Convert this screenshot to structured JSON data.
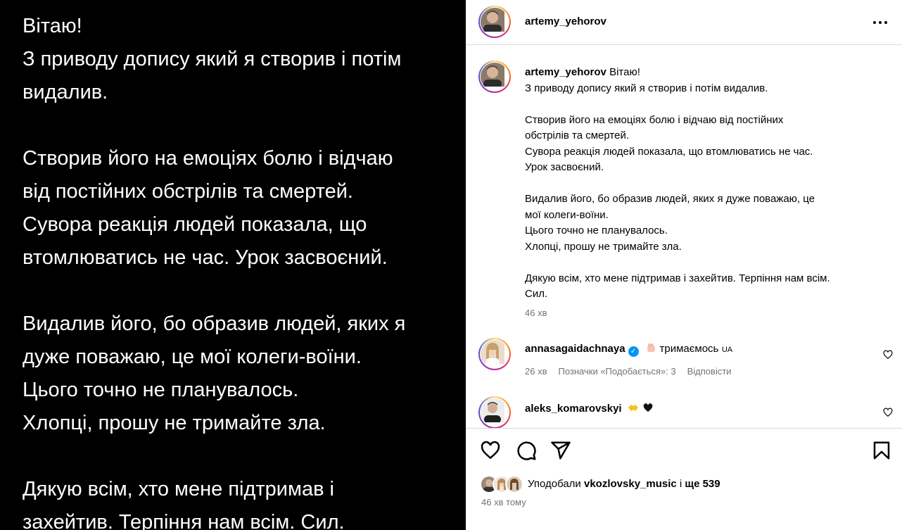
{
  "media": {
    "lines": [
      "Вітаю!",
      "З приводу допису який я створив і потім",
      "видалив.",
      "",
      "Створив його на емоціях болю і відчаю",
      "від постійних обстрілів та смертей.",
      "Сувора реакція людей показала, що",
      "втомлюватись не час. Урок засвоєний.",
      "",
      "Видалив його, бо образив людей, яких я",
      "дуже поважаю, це мої колеги-воїни.",
      "Цього точно не планувалось.",
      "Хлопці, прошу не тримайте зла.",
      "",
      "Дякую всім, хто мене підтримав і",
      "захейтив. Терпіння нам всім. Сил."
    ]
  },
  "header": {
    "username": "artemy_yehorov",
    "more_icon": "more-horizontal-icon"
  },
  "caption": {
    "username": "artemy_yehorov",
    "first_line": "Вітаю!",
    "lines": [
      "З приводу допису який я створив і потім видалив.",
      "",
      "Створив його на емоціях болю і відчаю від постійних",
      "обстрілів та смертей.",
      "Сувора реакція людей показала, що втомлюватись не час.",
      "Урок засвоєний.",
      "",
      "Видалив його, бо образив людей, яких я дуже поважаю, це",
      "мої колеги-воїни.",
      "Цього точно не планувалось.",
      "Хлопці, прошу не тримайте зла.",
      "",
      "Дякую всім, хто мене підтримав і захейтив. Терпіння нам всім.",
      "Сил."
    ],
    "time": "46 хв"
  },
  "comments": [
    {
      "username": "annasagaidachnaya",
      "verified": true,
      "text": "тримаємось",
      "flag": "UA",
      "time": "26 хв",
      "likes": "Позначки «Подобається»: 3",
      "reply": "Відповісти"
    },
    {
      "username": "aleks_komarovskyi",
      "verified": false,
      "text": ""
    }
  ],
  "actions": {
    "icons": [
      "heart-icon",
      "comment-icon",
      "share-icon",
      "bookmark-icon"
    ],
    "liked_by_prefix": "Уподобали",
    "liked_by_user": "vkozlovsky_music",
    "liked_by_and": "і",
    "liked_by_more": "ще 539",
    "post_time": "46 хв тому"
  },
  "colors": {
    "secondary_text": "#737373",
    "border": "#dbdbdb",
    "verified": "#0095f6"
  }
}
